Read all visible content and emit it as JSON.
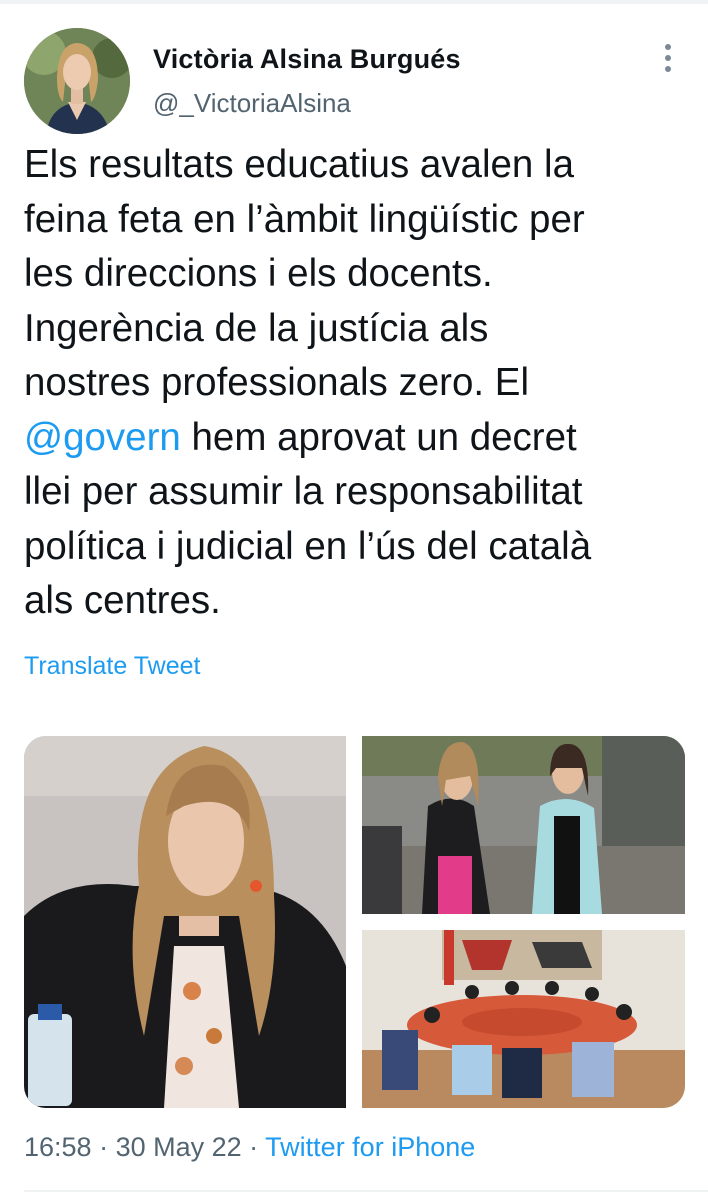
{
  "author": {
    "display_name": "Victòria Alsina Burgués",
    "handle": "@_VictoriaAlsina"
  },
  "tweet": {
    "text_before": "Els resultats educatius avalen la\nfeina feta en l’àmbit lingüístic per\nles direccions i els docents.\nIngerència de la justícia als\nnostres professionals zero. El\n",
    "mention": "@govern",
    "text_after": " hem aprovat un decret\nllei per assumir la responsabilitat\npolítica i judicial en l’ús del català\nals centres.",
    "translate_label": "Translate Tweet"
  },
  "media": {
    "photos": [
      "woman-portrait-photo",
      "officials-walking-photo",
      "cabinet-meeting-photo"
    ]
  },
  "meta": {
    "time": "16:58",
    "separator": " · ",
    "date": "30 May 22",
    "source": "Twitter for iPhone"
  },
  "colors": {
    "link": "#1d9bf0",
    "secondary_text": "#536471",
    "primary_text": "#0f1419"
  }
}
